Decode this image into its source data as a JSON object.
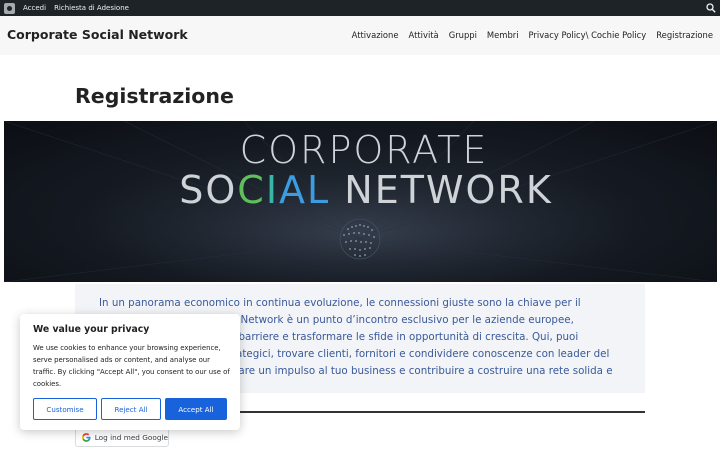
{
  "adminbar": {
    "items": [
      "Accedi",
      "Richiesta di Adesione"
    ],
    "logo_icon": "wordpress-logo-icon",
    "search_icon": "search-icon"
  },
  "header": {
    "site_title": "Corporate Social Network",
    "nav": [
      "Attivazione",
      "Attività",
      "Gruppi",
      "Membri",
      "Privacy Policy\\ Cochie Policy",
      "Registrazione"
    ]
  },
  "page": {
    "title": "Registrazione"
  },
  "hero": {
    "line1": "CORPORATE",
    "line2_a": "SO",
    "line2_c": "C",
    "line2_i": "I",
    "line2_al": "AL",
    "line2_b": " NETWORK",
    "colors": {
      "text": "#cfd3d8",
      "c_green": "#5fbf5a",
      "i_teal": "#38b6a8",
      "al_blue": "#3d9be0"
    }
  },
  "intro": {
    "text": "In un panorama economico in continua evoluzione, le connessioni giuste sono la chiave per il successo. Corporate Social Network è un punto d’incontro esclusivo per le aziende europee, progettato per superare le barriere e trasformare le sfide in opportunità di crescita. Qui, puoi connetterti con partner strategici, trovare clienti, fornitori e condividere conoscenze con leader del settore. Unisciti a noi per dare un impulso al tuo business e contribuire a costruire una rete solida e innovativa."
  },
  "google_login": {
    "label": "Log ind med Google",
    "icon": "google-icon"
  },
  "cookie": {
    "title": "We value your privacy",
    "text": "We use cookies to enhance your browsing experience, serve personalised ads or content, and analyse our traffic. By clicking \"Accept All\", you consent to our use of cookies.",
    "customise": "Customise",
    "reject": "Reject All",
    "accept": "Accept All",
    "accent": "#1863dc"
  }
}
